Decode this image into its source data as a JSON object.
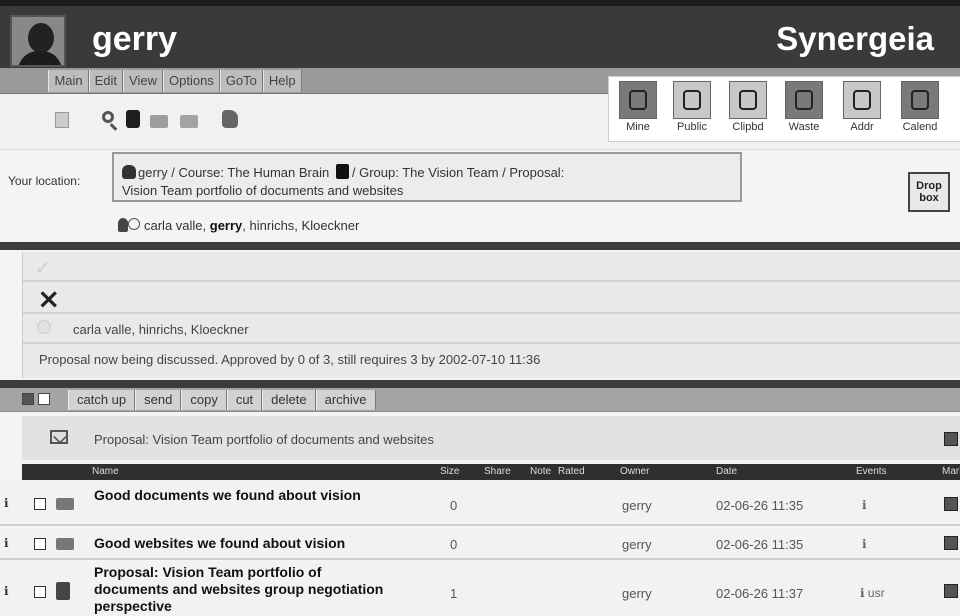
{
  "header": {
    "user": "gerry",
    "brand": "Synergeia"
  },
  "menu": [
    "Main",
    "Edit",
    "View",
    "Options",
    "GoTo",
    "Help"
  ],
  "big_icons": [
    {
      "label": "Mine",
      "icon": "hand-icon"
    },
    {
      "label": "Public",
      "icon": "public-icon"
    },
    {
      "label": "Clipbd",
      "icon": "clipboard-icon"
    },
    {
      "label": "Waste",
      "icon": "waste-icon"
    },
    {
      "label": "Addr",
      "icon": "address-book-icon"
    },
    {
      "label": "Calend",
      "icon": "calendar-icon"
    }
  ],
  "location": {
    "label": "Your location:",
    "path_part1": "gerry / Course: The Human Brain",
    "path_part2": "/ Group: The Vision Team / Proposal:",
    "path_part3": "Vision Team portfolio of documents and websites",
    "members_pre": "carla valle, ",
    "members_user": "gerry",
    "members_post": ", hinrichs, Kloeckner",
    "dropbox": "Drop box"
  },
  "approval": {
    "rejected_names": "carla valle, hinrichs, Kloeckner",
    "status": "Proposal now being discussed. Approved by 0 of 3, still requires 3 by 2002-07-10 11:36"
  },
  "actions": [
    "catch up",
    "send",
    "copy",
    "cut",
    "delete",
    "archive"
  ],
  "folder_title": "Proposal: Vision Team portfolio of documents and websites",
  "table": {
    "columns": [
      "Name",
      "Size",
      "Share",
      "Note",
      "Rated",
      "Owner",
      "Date",
      "Events",
      "Mark"
    ],
    "rows": [
      {
        "name": "Good documents we found about vision",
        "size": "0",
        "owner": "gerry",
        "date": "02-06-26 11:35",
        "events": "ℹ",
        "icon": "folder-icon"
      },
      {
        "name": "Good websites we found about vision",
        "size": "0",
        "owner": "gerry",
        "date": "02-06-26 11:35",
        "events": "ℹ",
        "icon": "folder-icon"
      },
      {
        "name": "Proposal: Vision Team portfolio of documents and websites group negotiation perspective",
        "size": "1",
        "owner": "gerry",
        "date": "02-06-26 11:37",
        "events": "ℹ usr",
        "icon": "proposal-icon"
      }
    ]
  }
}
